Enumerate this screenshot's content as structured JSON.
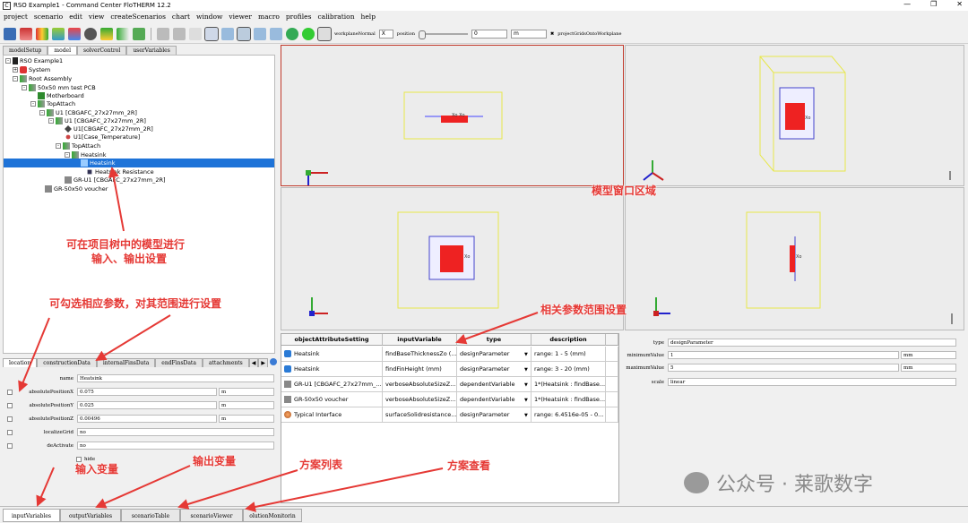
{
  "window": {
    "title": "RSO Example1 - Command Center FloTHERM 12.2",
    "icon_label": "C"
  },
  "menu": [
    "project",
    "scenario",
    "edit",
    "view",
    "createScenarios",
    "chart",
    "window",
    "viewer",
    "macro",
    "profiles",
    "calibration",
    "help"
  ],
  "toolbar": {
    "plane_label": "workplaneNormal",
    "plane_value": "X",
    "position_label": "position",
    "position_value": "0",
    "unit_value": "m",
    "project_label": "projectGridsOntoWorkplane"
  },
  "left_tabs": [
    "modelSetup",
    "model",
    "solverControl",
    "userVariables"
  ],
  "tree": [
    {
      "label": "RSO Example1",
      "level": 0,
      "icon": "project-icon"
    },
    {
      "label": "System",
      "level": 1,
      "icon": "system-icon"
    },
    {
      "label": "Root Assembly",
      "level": 1,
      "icon": "assembly-icon"
    },
    {
      "label": "50x50 mm test PCB",
      "level": 2,
      "icon": "assembly-icon"
    },
    {
      "label": "Motherboard",
      "level": 3,
      "icon": "pcb-icon"
    },
    {
      "label": "TopAttach",
      "level": 3,
      "icon": "assembly-icon"
    },
    {
      "label": "U1 [CBGAFC_27x27mm_2R]",
      "level": 4,
      "icon": "assembly-icon"
    },
    {
      "label": "U1 [CBGAFC_27x27mm_2R]",
      "level": 5,
      "icon": "assembly-icon"
    },
    {
      "label": "U1[CBGAFC_27x27mm_2R]",
      "level": 6,
      "icon": "component-icon"
    },
    {
      "label": "U1[Case_Temperature]",
      "level": 6,
      "icon": "monitor-icon"
    },
    {
      "label": "TopAttach",
      "level": 5,
      "icon": "assembly-icon"
    },
    {
      "label": "Heatsink",
      "level": 6,
      "icon": "assembly-icon"
    },
    {
      "label": "Heatsink",
      "level": 7,
      "icon": "heatsink-icon"
    },
    {
      "label": "Heatsink Resistance",
      "level": 7,
      "icon": "resistance-icon"
    },
    {
      "label": "GR-U1 [CBGAFC_27x27mm_2R]",
      "level": 5,
      "icon": "grid-icon"
    },
    {
      "label": "GR-50x50 voucher",
      "level": 3,
      "icon": "grid-icon"
    }
  ],
  "prop_tabs": [
    "location",
    "constructionData",
    "internalFinsData",
    "endFinsData",
    "attachments"
  ],
  "props": {
    "name_label": "name",
    "name_value": "Heatsink",
    "rows": [
      {
        "label": "absolutePositionX",
        "value": "0.075",
        "unit": "m"
      },
      {
        "label": "absolutePositionY",
        "value": "0.025",
        "unit": "m"
      },
      {
        "label": "absolutePositionZ",
        "value": "0.00496",
        "unit": "m"
      },
      {
        "label": "localizeGrid",
        "value": "no",
        "unit": ""
      },
      {
        "label": "deActivate",
        "value": "no",
        "unit": ""
      }
    ],
    "hide_label": "hide"
  },
  "grid": {
    "headers": [
      "objectAttributeSetting",
      "inputVariable",
      "type",
      "description"
    ],
    "rows": [
      {
        "obj": "Heatsink",
        "input": "findBaseThicknessZo (...",
        "type": "designParameter",
        "desc": "range: 1 - 5 (mm)",
        "icon": "heatsink-icon"
      },
      {
        "obj": "Heatsink",
        "input": "findFinHeight (mm)",
        "type": "designParameter",
        "desc": "range: 3 - 20 (mm)",
        "icon": "heatsink-icon"
      },
      {
        "obj": "GR-U1 [CBGAFC_27x27mm_...",
        "input": "verboseAbsoluteSizeZ...",
        "type": "dependentVariable",
        "desc": "1*(Heatsink : findBase...",
        "icon": "grid-icon"
      },
      {
        "obj": "GR-50x50 voucher",
        "input": "verboseAbsoluteSizeZ...",
        "type": "dependentVariable",
        "desc": "1*(Heatsink : findBase...",
        "icon": "grid-icon"
      },
      {
        "obj": "Typical Interface",
        "input": "surfaceSolidresistance...",
        "type": "designParameter",
        "desc": "range: 6.4516e-05 - 0...",
        "icon": "material-icon"
      }
    ]
  },
  "right_panel": {
    "type_label": "type",
    "type_value": "designParameter",
    "min_label": "minimumValue",
    "min_value": "1",
    "min_unit": "mm",
    "max_label": "maximumValue",
    "max_value": "5",
    "max_unit": "mm",
    "scale_label": "scale",
    "scale_value": "linear"
  },
  "bottom_tabs": [
    "inputVariables",
    "outputVariables",
    "scenarioTable",
    "scenarioViewer",
    "olutionMonitorin"
  ],
  "annotations": {
    "model_window": "模型窗口区域",
    "tree_note_1": "可在项目树中的模型进行",
    "tree_note_2": "输入、输出设置",
    "check_note": "可勾选相应参数，对其范围进行设置",
    "range_note": "相关参数范围设置",
    "input_var": "输入变量",
    "output_var": "输出变量",
    "scenario_list": "方案列表",
    "scenario_view": "方案查看"
  },
  "watermark": "公众号 · 莱歌数字",
  "colors": {
    "accent_red": "#e53935",
    "selection": "#1e73d8"
  }
}
